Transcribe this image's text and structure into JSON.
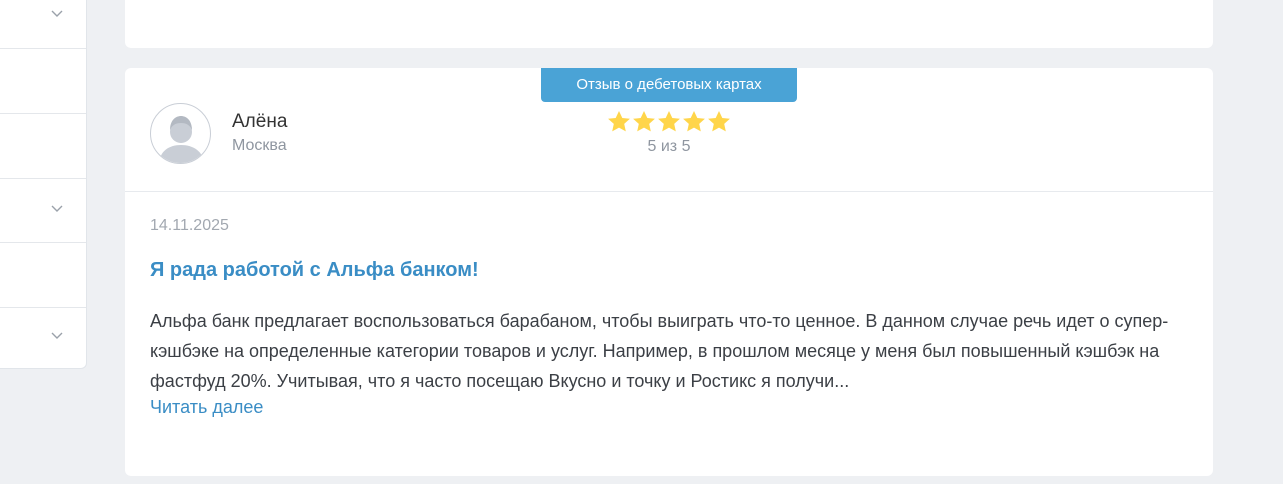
{
  "sidebar": {
    "rows": [
      {
        "has_chevron": true
      },
      {
        "has_chevron": false
      },
      {
        "has_chevron": false
      },
      {
        "has_chevron": true
      },
      {
        "has_chevron": false
      },
      {
        "has_chevron": true
      }
    ]
  },
  "review": {
    "badge": "Отзыв о дебетовых картах",
    "author": {
      "name": "Алёна",
      "city": "Москва",
      "avatar_icon": "user-avatar-icon"
    },
    "rating": {
      "value": 5,
      "max": 5,
      "text": "5 из 5",
      "star_color": "#ffd54a"
    },
    "date": "14.11.2025",
    "title": "Я рада работой с Альфа банком!",
    "text": "Альфа банк предлагает воспользоваться барабаном, чтобы выиграть что-то ценное. В данном случае речь идет о супер-кэшбэке на определенные категории товаров и услуг. Например, в прошлом месяце у меня был повышенный кэшбэк на фастфуд 20%. Учитывая, что я часто посещаю Вкусно и точку и Ростикс я получи...",
    "read_more": "Читать далее"
  },
  "colors": {
    "accent": "#4aa3d6",
    "link": "#3a8dc5",
    "background": "#eef0f3"
  }
}
